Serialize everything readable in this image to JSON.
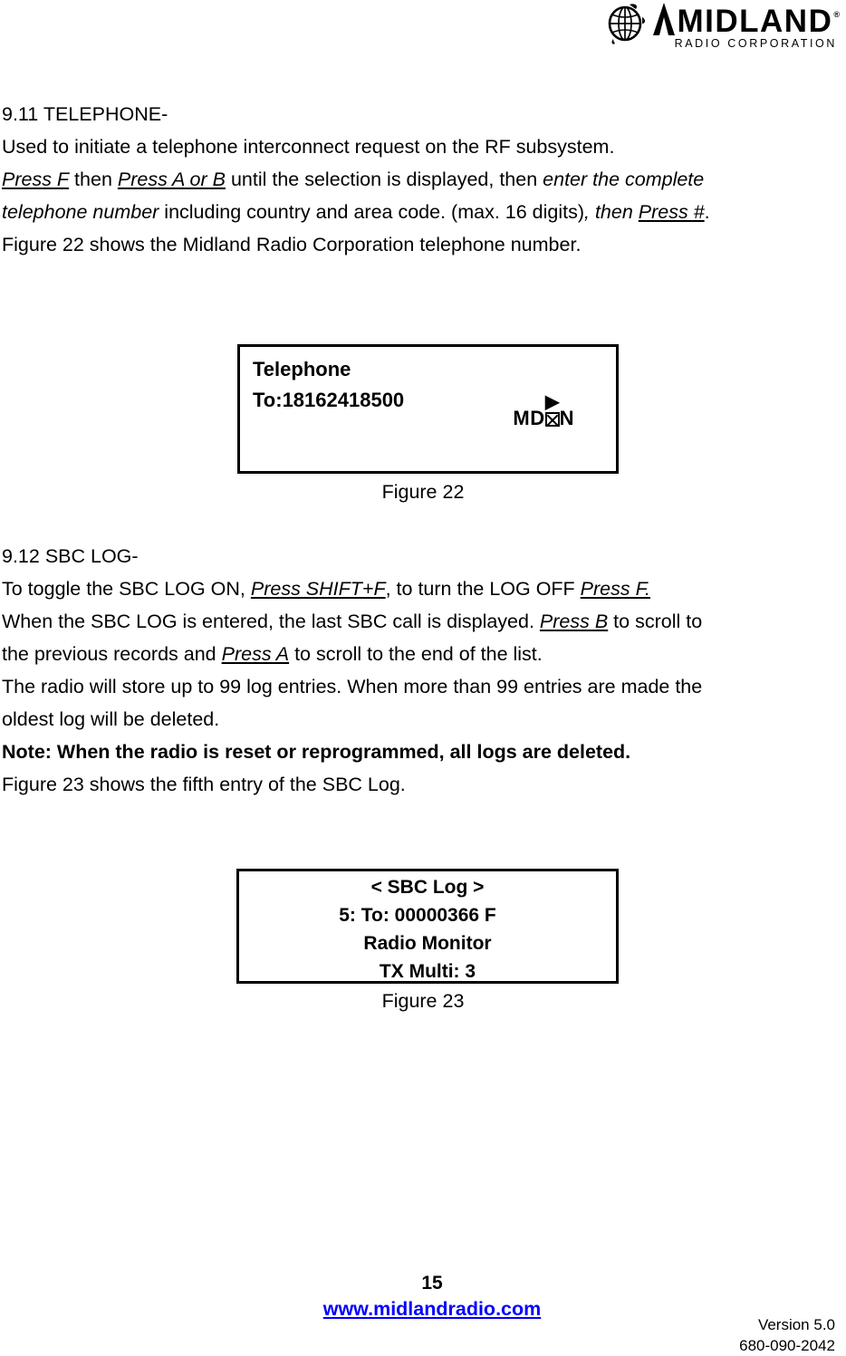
{
  "header": {
    "logo_brand": "MIDLAND",
    "logo_registered": "®",
    "logo_subtitle": "RADIO CORPORATION",
    "globe_icon": "globe-icon"
  },
  "content": {
    "section_911": {
      "heading": "9.11 TELEPHONE-",
      "line1": "Used to initiate a telephone interconnect request on the RF subsystem.",
      "p2_a": "Press F",
      "p2_b": " then ",
      "p2_c": "Press A or B",
      "p2_d": " until the selection is displayed, then ",
      "p2_e": "enter the complete",
      "p3_a": "telephone number",
      "p3_b": " including country and area code. (max. 16 digits)",
      "p3_c": ", then ",
      "p3_d": "Press #",
      "p3_e": ".",
      "line4": "Figure 22 shows the Midland Radio Corporation telephone number."
    },
    "section_912": {
      "heading": "9.12 SBC LOG-",
      "p1_a": "To toggle the SBC LOG ON, ",
      "p1_b": "Press SHIFT+F",
      "p1_c": ", to turn the LOG OFF ",
      "p1_d": "Press F.",
      "p2_a": "When the SBC LOG is entered, the last SBC call is displayed. ",
      "p2_b": "Press B",
      "p2_c": " to scroll to",
      "p3_a": "the previous records and ",
      "p3_b": "Press A",
      "p3_c": " to scroll to the end of the list.",
      "p4": "The radio will store up to 99 log entries. When more than 99 entries are made the",
      "p5": "oldest log will be deleted.",
      "note": "Note: When the radio is reset or reprogrammed, all logs are deleted.",
      "p6": "Figure 23 shows the fifth entry of the SBC Log."
    }
  },
  "figure22": {
    "caption": "Figure 22",
    "lcd": {
      "line1": "Telephone",
      "line2": "To:18162418500",
      "arrow_icon": "▶",
      "status_prefix": "MD",
      "status_suffix": "N"
    }
  },
  "figure23": {
    "caption": "Figure 23",
    "lcd": {
      "line1": "< SBC Log >",
      "line2": "5:    To: 00000366   F",
      "line3": "Radio Monitor",
      "line4": "TX Multi: 3"
    }
  },
  "footer": {
    "page_number": "15",
    "website": "www.midlandradio.com",
    "version": "Version 5.0",
    "doc_number": "680-090-2042"
  }
}
